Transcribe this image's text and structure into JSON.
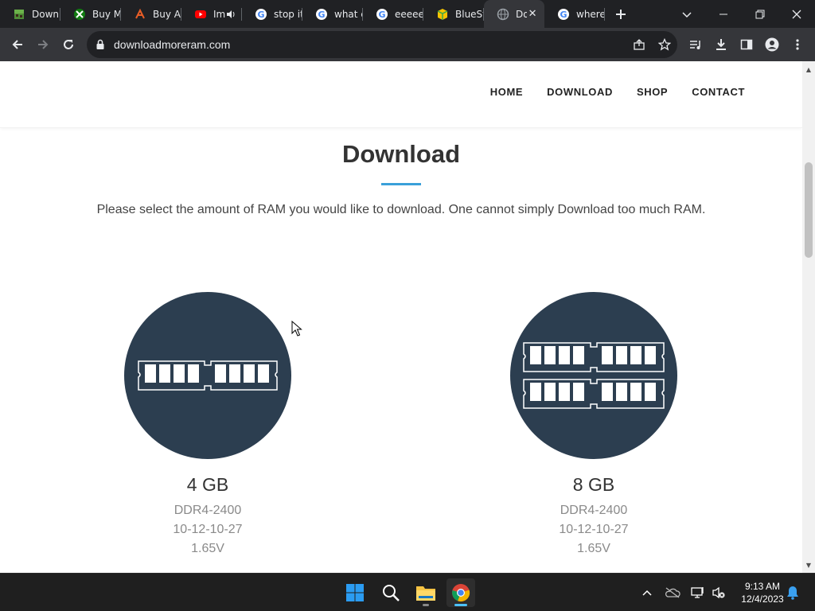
{
  "browser": {
    "tabs": [
      {
        "title": "Downl",
        "icon": "minecraft-icon",
        "active": false
      },
      {
        "title": "Buy M",
        "icon": "xbox-icon",
        "active": false
      },
      {
        "title": "Buy Ar",
        "icon": "arrow-logo-icon",
        "active": false
      },
      {
        "title": "Ima",
        "icon": "youtube-icon",
        "active": false,
        "audio": true
      },
      {
        "title": "stop it",
        "icon": "google-icon",
        "active": false
      },
      {
        "title": "what c",
        "icon": "google-icon",
        "active": false
      },
      {
        "title": "eeeee",
        "icon": "google-icon",
        "active": false
      },
      {
        "title": "BlueSt",
        "icon": "bluestacks-icon",
        "active": false
      },
      {
        "title": "Do",
        "icon": "globe-icon",
        "active": true
      },
      {
        "title": "where",
        "icon": "google-icon",
        "active": false
      }
    ],
    "url": "downloadmoreram.com"
  },
  "site": {
    "nav": [
      "HOME",
      "DOWNLOAD",
      "SHOP",
      "CONTACT"
    ],
    "title": "Download",
    "intro": "Please select the amount of RAM you would like to download. One cannot simply Download too much RAM.",
    "products": [
      {
        "size": "4 GB",
        "type": "DDR4-2400",
        "timings": "10-12-10-27",
        "voltage": "1.65V",
        "modules": 1
      },
      {
        "size": "8 GB",
        "type": "DDR4-2400",
        "timings": "10-12-10-27",
        "voltage": "1.65V",
        "modules": 2
      }
    ]
  },
  "taskbar": {
    "time": "9:13 AM",
    "date": "12/4/2023"
  },
  "colors": {
    "accent": "#3aa0d9",
    "circle": "#2c3e50",
    "tabstrip": "#202124",
    "toolbar": "#35363a"
  }
}
